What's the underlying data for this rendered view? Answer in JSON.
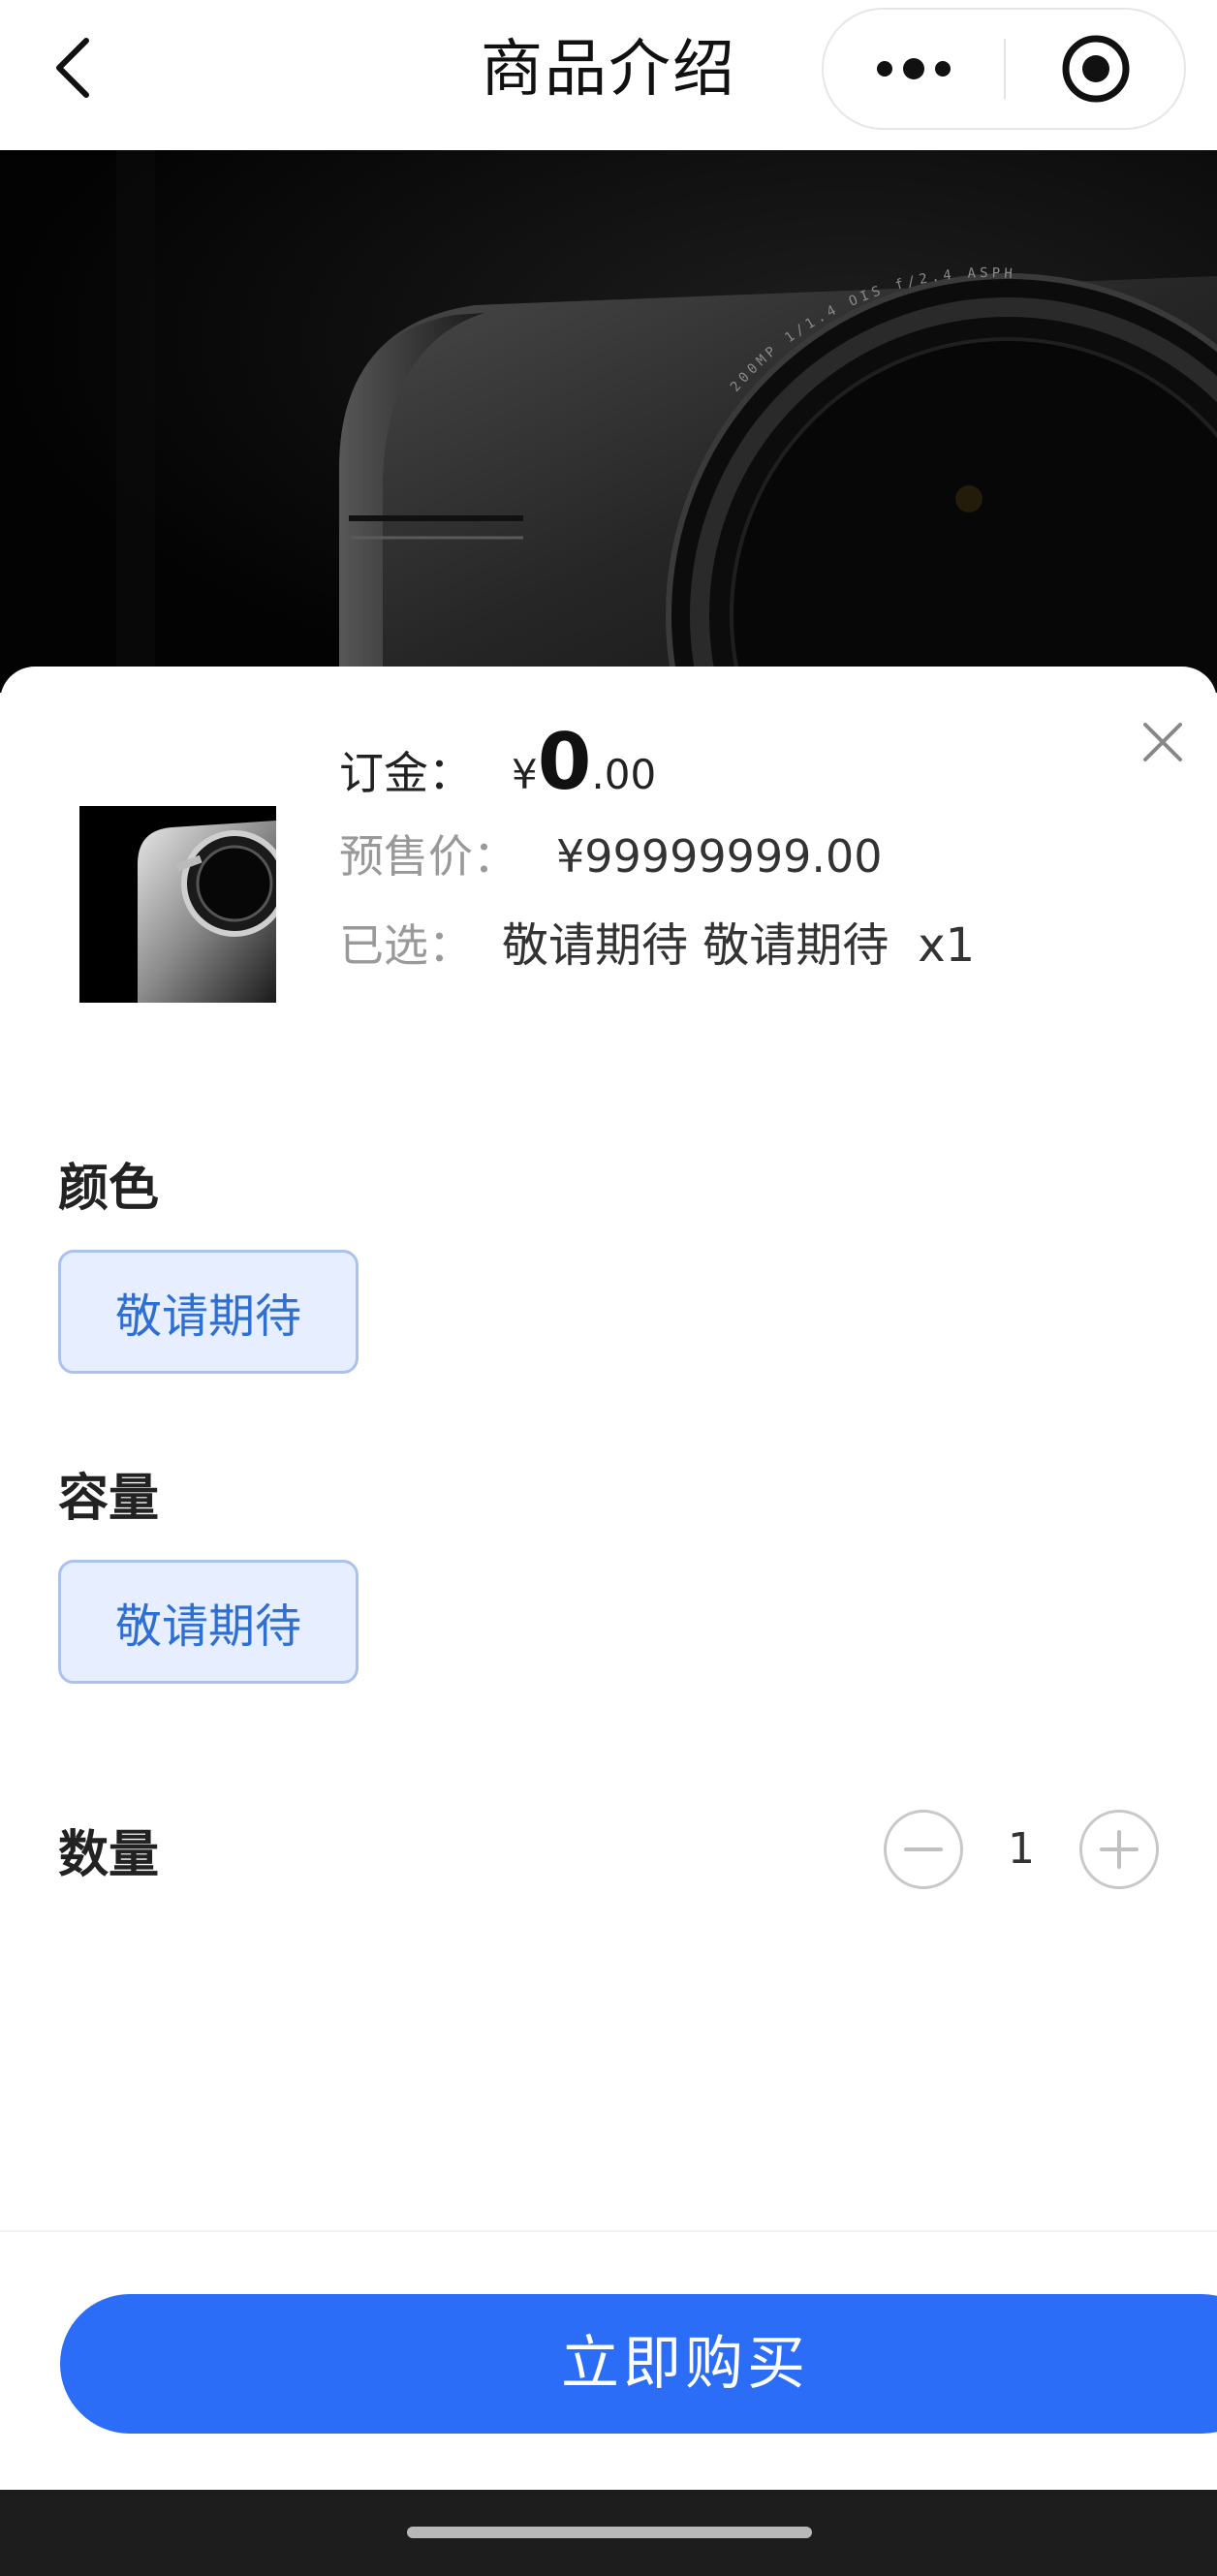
{
  "navbar": {
    "title": "商品介绍",
    "back_icon": "chevron-left-icon",
    "more_icon": "more-dots-icon",
    "close_icon": "target-circle-icon"
  },
  "hero": {
    "lens_text": "200MP 1/1.4 OIS f/2.4 ASPH"
  },
  "sheet": {
    "close_icon": "close-x-icon",
    "deposit": {
      "label": "订金：",
      "currency": "¥",
      "integer": "0",
      "decimal": ".00"
    },
    "presale": {
      "label": "预售价：",
      "value": "¥99999999.00"
    },
    "selected": {
      "label": "已选：",
      "value": "敬请期待 敬请期待",
      "quantity": "x1"
    },
    "color_section": {
      "title": "颜色",
      "option": "敬请期待"
    },
    "capacity_section": {
      "title": "容量",
      "option": "敬请期待"
    },
    "quantity_section": {
      "title": "数量",
      "value": "1"
    },
    "buy_button": "立即购买"
  },
  "colors": {
    "accent": "#2b6df6",
    "chip_bg": "#e6eeff",
    "chip_text": "#2f6fd1"
  }
}
